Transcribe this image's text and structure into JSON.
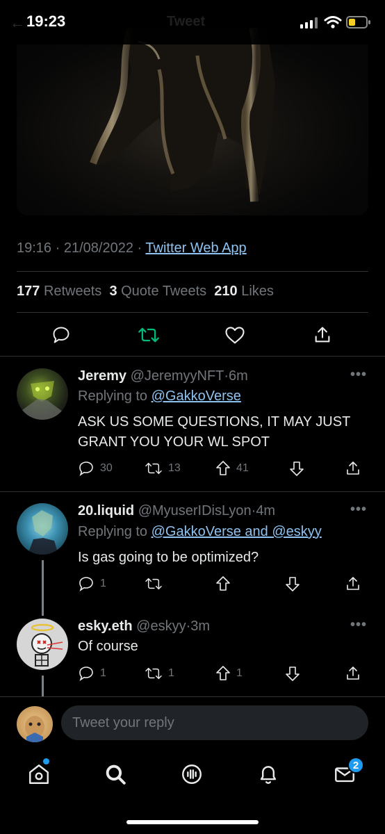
{
  "status_bar": {
    "time": "19:23"
  },
  "header": {
    "title": "Tweet",
    "back_icon": "back-arrow-icon"
  },
  "tweet": {
    "time": "19:16",
    "date": "21/08/2022",
    "separator": "·",
    "source": "Twitter Web App",
    "retweets": "177",
    "retweets_label": "Retweets",
    "quotes": "3",
    "quotes_label": "Quote Tweets",
    "likes": "210",
    "likes_label": "Likes",
    "accent_retweet_color": "#00ba7c"
  },
  "replies": [
    {
      "name": "Jeremy",
      "handle": "@JeremyyNFT",
      "time": "6m",
      "replying_prefix": "Replying to",
      "replying_to": "@GakkoVerse",
      "text": "ASK US SOME QUESTIONS, IT MAY JUST GRANT YOU YOUR WL SPOT",
      "reply_count": "30",
      "retweet_count": "13",
      "upvote_count": "41"
    },
    {
      "name": "20.liquid",
      "handle": "@MyuserIDisLyon",
      "time": "4m",
      "replying_prefix": "Replying to",
      "replying_to": "@GakkoVerse and @eskyy",
      "text": "Is gas going to be optimized?",
      "reply_count": "1",
      "retweet_count": "",
      "upvote_count": ""
    },
    {
      "name": "esky.eth",
      "handle": "@eskyy",
      "time": "3m",
      "text": "Of course",
      "reply_count": "1",
      "retweet_count": "1",
      "upvote_count": "1"
    }
  ],
  "composer": {
    "placeholder": "Tweet your reply"
  },
  "tabbar": {
    "messages_badge": "2"
  },
  "colors": {
    "link": "#8ec2f0",
    "muted": "#71767b",
    "badge": "#1d9bf0"
  }
}
